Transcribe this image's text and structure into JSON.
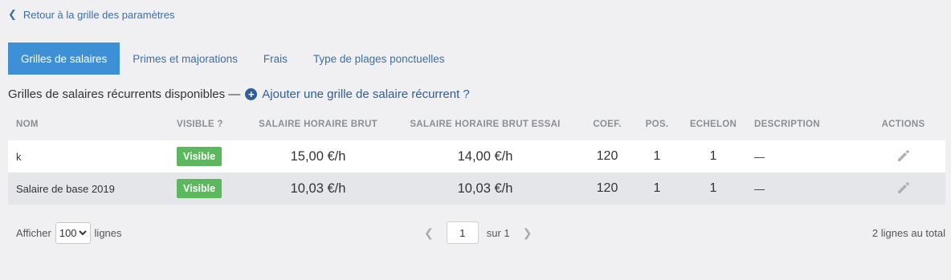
{
  "back_link": {
    "label": "Retour à la grille des paramètres"
  },
  "tabs": [
    {
      "label": "Grilles de salaires",
      "active": true
    },
    {
      "label": "Primes et majorations",
      "active": false
    },
    {
      "label": "Frais",
      "active": false
    },
    {
      "label": "Type de plages ponctuelles",
      "active": false
    }
  ],
  "section": {
    "title": "Grilles de salaires récurrents disponibles —",
    "add_link": "Ajouter une grille de salaire récurrent ?"
  },
  "table": {
    "headers": {
      "name": "NOM",
      "visible": "VISIBLE ?",
      "shb": "SALAIRE HORAIRE BRUT",
      "shbe": "SALAIRE HORAIRE BRUT ESSAI",
      "coef": "COEF.",
      "pos": "POS.",
      "echelon": "ECHELON",
      "description": "DESCRIPTION",
      "actions": "ACTIONS"
    },
    "rows": [
      {
        "name": "k",
        "visible": "Visible",
        "shb": "15,00 €/h",
        "shbe": "14,00 €/h",
        "coef": "120",
        "pos": "1",
        "echelon": "1",
        "description": "—",
        "action_icon": "pencil-icon"
      },
      {
        "name": "Salaire de base 2019",
        "visible": "Visible",
        "shb": "10,03 €/h",
        "shbe": "10,03 €/h",
        "coef": "120",
        "pos": "1",
        "echelon": "1",
        "description": "—",
        "action_icon": "pencil-icon"
      }
    ]
  },
  "footer": {
    "show_label": "Afficher",
    "lines_per_page": "100",
    "lines_label": "lignes",
    "current_page": "1",
    "of_label": "sur 1",
    "total": "2 lignes au total"
  },
  "colors": {
    "accent": "#3d8fd6",
    "link": "#3b6fa8",
    "badge": "#5cb85c",
    "background": "#f0f0f2"
  }
}
